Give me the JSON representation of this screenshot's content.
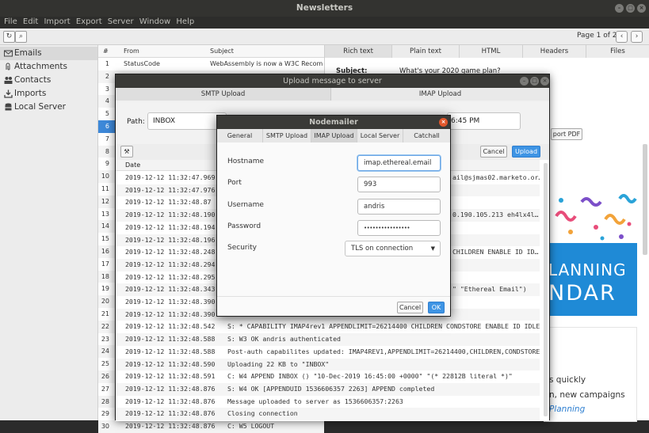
{
  "window": {
    "title": "Newsletters"
  },
  "menu": [
    "File",
    "Edit",
    "Import",
    "Export",
    "Server",
    "Window",
    "Help"
  ],
  "toolbar": {
    "page_label": "Page 1 of 2"
  },
  "sidebar": {
    "items": [
      {
        "label": "Emails",
        "icon": "envelope-icon"
      },
      {
        "label": "Attachments",
        "icon": "paperclip-icon"
      },
      {
        "label": "Contacts",
        "icon": "people-icon"
      },
      {
        "label": "Imports",
        "icon": "download-icon"
      },
      {
        "label": "Local Server",
        "icon": "database-icon"
      }
    ]
  },
  "message_list": {
    "headers": {
      "num": "#",
      "from": "From",
      "subject": "Subject"
    },
    "rows": [
      {
        "num": "1",
        "from": "StatusCode",
        "subject": "WebAssembly is now a W3C Recom..."
      },
      {
        "num": "2",
        "from": "",
        "subject": ""
      },
      {
        "num": "3",
        "from": "",
        "subject": ""
      },
      {
        "num": "4",
        "from": "",
        "subject": ""
      },
      {
        "num": "5",
        "from": "",
        "subject": ""
      },
      {
        "num": "6",
        "from": "",
        "subject": ""
      },
      {
        "num": "7",
        "from": "",
        "subject": ""
      },
      {
        "num": "8",
        "from": "",
        "subject": ""
      },
      {
        "num": "9",
        "from": "",
        "subject": ""
      },
      {
        "num": "10",
        "from": "",
        "subject": ""
      },
      {
        "num": "11",
        "from": "",
        "subject": ""
      },
      {
        "num": "12",
        "from": "",
        "subject": ""
      },
      {
        "num": "13",
        "from": "",
        "subject": ""
      },
      {
        "num": "14",
        "from": "",
        "subject": ""
      },
      {
        "num": "15",
        "from": "",
        "subject": ""
      },
      {
        "num": "16",
        "from": "",
        "subject": ""
      },
      {
        "num": "17",
        "from": "",
        "subject": ""
      },
      {
        "num": "18",
        "from": "",
        "subject": ""
      },
      {
        "num": "19",
        "from": "",
        "subject": ""
      },
      {
        "num": "20",
        "from": "",
        "subject": ""
      },
      {
        "num": "21",
        "from": "",
        "subject": ""
      },
      {
        "num": "22",
        "from": "",
        "subject": ""
      },
      {
        "num": "23",
        "from": "",
        "subject": ""
      },
      {
        "num": "24",
        "from": "",
        "subject": ""
      },
      {
        "num": "25",
        "from": "",
        "subject": ""
      },
      {
        "num": "26",
        "from": "",
        "subject": ""
      },
      {
        "num": "27",
        "from": "",
        "subject": ""
      },
      {
        "num": "28",
        "from": "",
        "subject": ""
      },
      {
        "num": "29",
        "from": "",
        "subject": ""
      },
      {
        "num": "30",
        "from": "",
        "subject": ""
      }
    ],
    "selected_row": "6"
  },
  "preview": {
    "tabs": [
      "Rich text",
      "Plain text",
      "HTML",
      "Headers",
      "Files"
    ],
    "subject_label": "Subject:",
    "subject_value": "What's your 2020 game plan?",
    "export_pdf": "port PDF",
    "banner_line1": "LANNING",
    "banner_line2": "NDAR",
    "text_line1": "s quickly",
    "text_line2": "n, new campaigns",
    "text_line3": "Planning"
  },
  "upload": {
    "title": "Upload message to server",
    "tabs": [
      "SMTP Upload",
      "IMAP Upload"
    ],
    "path_label": "Path:",
    "path_value": "INBOX",
    "date_fragment": "6:45 PM",
    "cancel": "Cancel",
    "upload": "Upload",
    "log_header": "Date",
    "log": [
      {
        "ts": "2019-12-12 11:32:47.969",
        "msg": "",
        "tail": "ail@sjmas02.marketo.or…"
      },
      {
        "ts": "2019-12-12 11:32:47.976",
        "msg": "",
        "tail": ""
      },
      {
        "ts": "2019-12-12 11:32:48.87",
        "msg": "",
        "tail": ""
      },
      {
        "ts": "2019-12-12 11:32:48.190",
        "msg": "",
        "tail": "0.190.105.213 eh4lx4l…"
      },
      {
        "ts": "2019-12-12 11:32:48.194",
        "msg": "",
        "tail": ""
      },
      {
        "ts": "2019-12-12 11:32:48.196",
        "msg": "",
        "tail": ""
      },
      {
        "ts": "2019-12-12 11:32:48.248",
        "msg": "",
        "tail": "CHILDREN ENABLE ID ID…"
      },
      {
        "ts": "2019-12-12 11:32:48.294",
        "msg": "",
        "tail": ""
      },
      {
        "ts": "2019-12-12 11:32:48.295",
        "msg": "",
        "tail": ""
      },
      {
        "ts": "2019-12-12 11:32:48.343",
        "msg": "",
        "tail": "\" \"Ethereal Email\")"
      },
      {
        "ts": "2019-12-12 11:32:48.390",
        "msg": "",
        "tail": ""
      },
      {
        "ts": "2019-12-12 11:32:48.390",
        "msg": "",
        "tail": ""
      },
      {
        "ts": "2019-12-12 11:32:48.542",
        "msg": "S: * CAPABILITY IMAP4rev1 APPENDLIMIT=26214400 CHILDREN CONDSTORE ENABLE ID IDLE …",
        "tail": ""
      },
      {
        "ts": "2019-12-12 11:32:48.588",
        "msg": "S: W3 OK andris authenticated",
        "tail": ""
      },
      {
        "ts": "2019-12-12 11:32:48.588",
        "msg": "Post-auth capabilites updated: IMAP4REV1,APPENDLIMIT=26214400,CHILDREN,CONDSTORE,…",
        "tail": ""
      },
      {
        "ts": "2019-12-12 11:32:48.590",
        "msg": "Uploading 22 KB to \"INBOX\"",
        "tail": ""
      },
      {
        "ts": "2019-12-12 11:32:48.591",
        "msg": "C: W4 APPEND INBOX () \"10-Dec-2019 16:45:00 +0000\" \"(* 22812B literal *)\"",
        "tail": ""
      },
      {
        "ts": "2019-12-12 11:32:48.876",
        "msg": "S: W4 OK [APPENDUID 1536606357 2263] APPEND completed",
        "tail": ""
      },
      {
        "ts": "2019-12-12 11:32:48.876",
        "msg": "Message uploaded to server as 1536606357:2263",
        "tail": ""
      },
      {
        "ts": "2019-12-12 11:32:48.876",
        "msg": "Closing connection",
        "tail": ""
      },
      {
        "ts": "2019-12-12 11:32:48.876",
        "msg": "C: W5 LOGOUT",
        "tail": ""
      }
    ]
  },
  "nodemailer": {
    "title": "Nodemailer",
    "tabs": [
      "General",
      "SMTP Upload",
      "IMAP Upload",
      "Local Server",
      "Catchall"
    ],
    "active_tab": "IMAP Upload",
    "fields": [
      {
        "label": "Hostname",
        "value": "imap.ethereal.email"
      },
      {
        "label": "Port",
        "value": "993"
      },
      {
        "label": "Username",
        "value": "andris"
      },
      {
        "label": "Password",
        "value": "••••••••••••••••"
      }
    ],
    "security_label": "Security",
    "security_value": "TLS on connection",
    "cancel": "Cancel",
    "ok": "OK"
  },
  "colors": {
    "accent": "#3d88d8",
    "titlebar": "#333330",
    "close_button": "#e2572b"
  }
}
